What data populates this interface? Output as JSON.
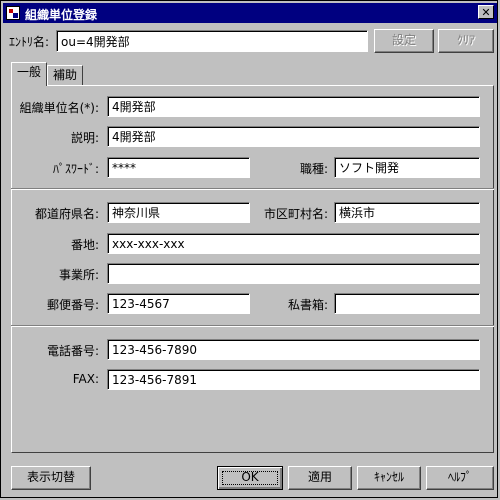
{
  "window": {
    "title": "組織単位登録",
    "close_glyph": "✕"
  },
  "entry": {
    "label": "ｴﾝﾄﾘ名:",
    "value": "ou=4開発部",
    "set_label": "設定",
    "clear_label": "ｸﾘｱ"
  },
  "tabs": [
    {
      "label": "一般"
    },
    {
      "label": "補助"
    }
  ],
  "form": {
    "unit_name": {
      "label": "組織単位名(*):",
      "value": "4開発部"
    },
    "description": {
      "label": "説明:",
      "value": "4開発部"
    },
    "password": {
      "label": "ﾊﾟｽﾜｰﾄﾞ:",
      "value": "****"
    },
    "job_type": {
      "label": "職種:",
      "value": "ソフト開発"
    },
    "prefecture": {
      "label": "都道府県名:",
      "value": "神奈川県"
    },
    "city": {
      "label": "市区町村名:",
      "value": "横浜市"
    },
    "address": {
      "label": "番地:",
      "value": "xxx-xxx-xxx"
    },
    "office": {
      "label": "事業所:",
      "value": ""
    },
    "postal_code": {
      "label": "郵便番号:",
      "value": "123-4567"
    },
    "po_box": {
      "label": "私書箱:",
      "value": ""
    },
    "phone": {
      "label": "電話番号:",
      "value": "123-456-7890"
    },
    "fax": {
      "label": "FAX:",
      "value": "123-456-7891"
    }
  },
  "footer": {
    "toggle_label": "表示切替",
    "ok_label": "OK",
    "apply_label": "適用",
    "cancel_label": "ｷｬﾝｾﾙ",
    "help_label": "ﾍﾙﾌﾟ"
  }
}
